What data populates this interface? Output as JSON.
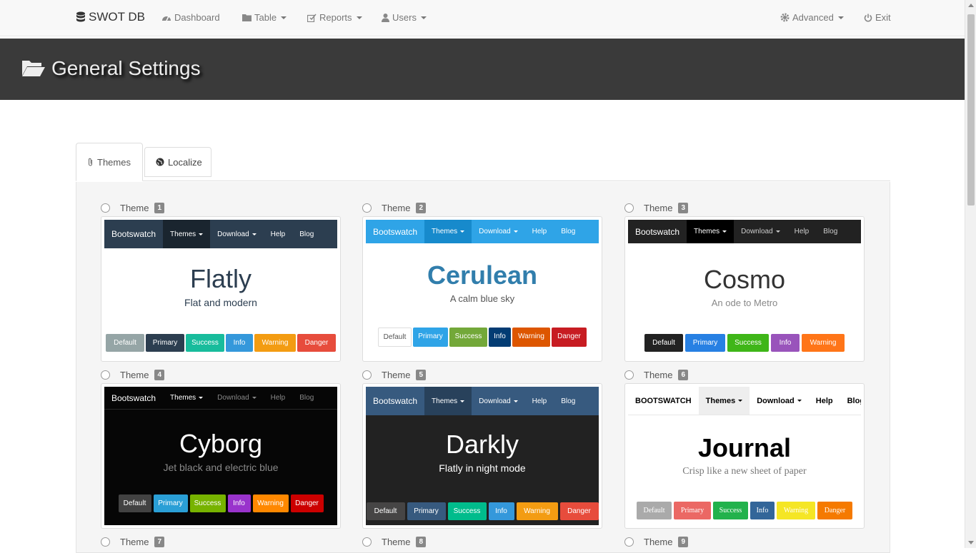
{
  "navbar": {
    "brand": "SWOT DB",
    "items": [
      {
        "label": "Dashboard"
      },
      {
        "label": "Table"
      },
      {
        "label": "Reports"
      },
      {
        "label": "Users"
      },
      {
        "label": "Advanced"
      },
      {
        "label": "Exit"
      }
    ]
  },
  "header": {
    "title": "General Settings"
  },
  "tabs": [
    {
      "label": "Themes"
    },
    {
      "label": "Localize"
    }
  ],
  "theme_word": "Theme",
  "themes": [
    {
      "num": "1",
      "name": "Flatly",
      "tagline": "Flat and modern",
      "brand": "Bootswatch",
      "links": [
        "Themes",
        "Download",
        "Help",
        "Blog"
      ],
      "buttons": [
        "Default",
        "Primary",
        "Success",
        "Info",
        "Warning",
        "Danger"
      ]
    },
    {
      "num": "2",
      "name": "Cerulean",
      "tagline": "A calm blue sky",
      "brand": "Bootswatch",
      "links": [
        "Themes",
        "Download",
        "Help",
        "Blog"
      ],
      "buttons": [
        "Default",
        "Primary",
        "Success",
        "Info",
        "Warning",
        "Danger"
      ]
    },
    {
      "num": "3",
      "name": "Cosmo",
      "tagline": "An ode to Metro",
      "brand": "Bootswatch",
      "links": [
        "Themes",
        "Download",
        "Help",
        "Blog"
      ],
      "buttons": [
        "Default",
        "Primary",
        "Success",
        "Info",
        "Warning"
      ]
    },
    {
      "num": "4",
      "name": "Cyborg",
      "tagline": "Jet black and electric blue",
      "brand": "Bootswatch",
      "links": [
        "Themes",
        "Download",
        "Help",
        "Blog"
      ],
      "buttons": [
        "Default",
        "Primary",
        "Success",
        "Info",
        "Warning",
        "Danger"
      ]
    },
    {
      "num": "5",
      "name": "Darkly",
      "tagline": "Flatly in night mode",
      "brand": "Bootswatch",
      "links": [
        "Themes",
        "Download",
        "Help",
        "Blog"
      ],
      "buttons": [
        "Default",
        "Primary",
        "Success",
        "Info",
        "Warning",
        "Danger"
      ]
    },
    {
      "num": "6",
      "name": "Journal",
      "tagline": "Crisp like a new sheet of paper",
      "brand": "BOOTSWATCH",
      "links": [
        "Themes",
        "Download",
        "Help",
        "Blog"
      ],
      "buttons": [
        "Default",
        "Primary",
        "Success",
        "Info",
        "Warning",
        "Danger"
      ]
    },
    {
      "num": "7"
    },
    {
      "num": "8"
    },
    {
      "num": "9"
    }
  ],
  "colors": {
    "navbar_bg": "#f8f8f8",
    "header_bg": "#3a3a3a",
    "badge": "#888888"
  }
}
